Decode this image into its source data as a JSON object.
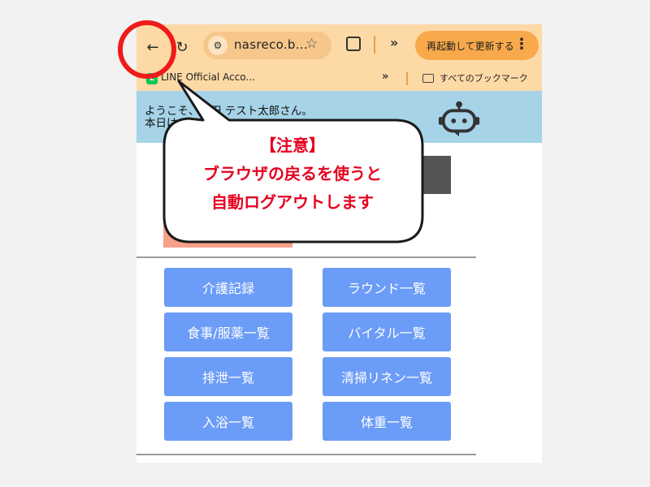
{
  "browser": {
    "url_text": "nasreco.b...",
    "restart_label": "再起動して更新する",
    "bookmark_line_label": "LINE Official Acco...",
    "all_bookmarks_label": "すべてのブックマーク",
    "line_icon_letter": "L"
  },
  "page": {
    "welcome_line1": "ようこそ、山田 テスト太郎さん。",
    "welcome_line2": "本日は"
  },
  "menu": {
    "left": [
      "介護記録",
      "食事/服薬一覧",
      "排泄一覧",
      "入浴一覧"
    ],
    "right": [
      "ラウンド一覧",
      "バイタル一覧",
      "清掃リネン一覧",
      "体重一覧"
    ]
  },
  "annotation": {
    "title": "【注意】",
    "line1": "ブラウザの戻るを使うと",
    "line2": "自動ログアウトします"
  },
  "colors": {
    "chrome_bg": "#fdd9a6",
    "restart_button": "#f8a94b",
    "header_band": "#a6d3e8",
    "menu_button": "#6b9cf7",
    "warning_text": "#e5001e",
    "highlight_circle": "#ef1b1b"
  },
  "icons": {
    "back": "back-arrow-icon",
    "reload": "reload-icon",
    "site_info": "tune-icon",
    "bookmark": "star-icon",
    "extensions": "puzzle-icon",
    "more": "kebab-menu-icon",
    "folder": "folder-icon",
    "assistant": "robot-icon"
  }
}
